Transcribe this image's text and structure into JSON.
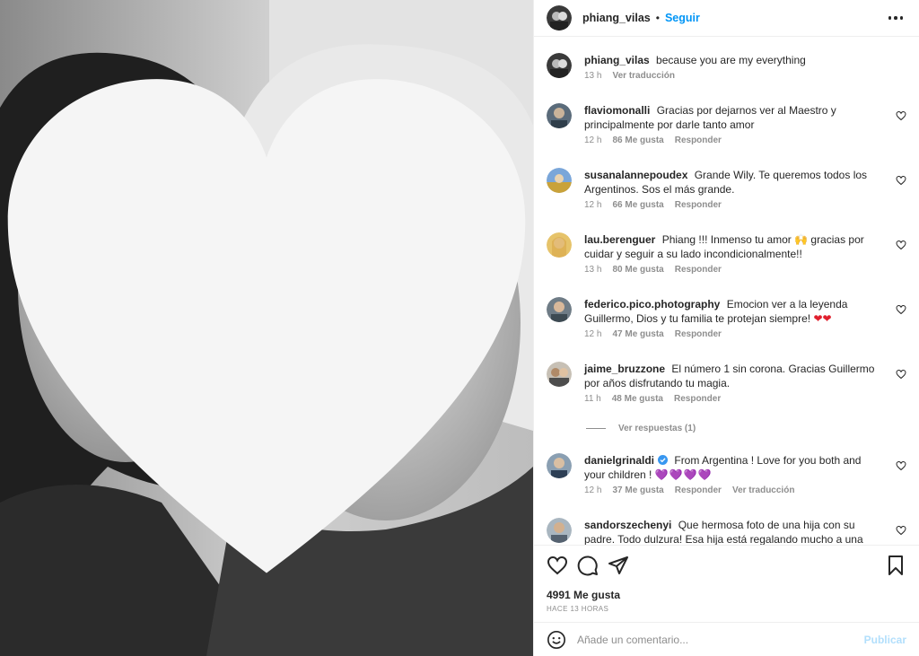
{
  "header": {
    "username": "phiang_vilas",
    "separator": "•",
    "follow_label": "Seguir",
    "more_icon": "more-options-icon"
  },
  "caption": {
    "username": "phiang_vilas",
    "text": "because you are my everything",
    "time": "13 h",
    "translate": "Ver traducción"
  },
  "comments": [
    {
      "username": "flaviomonalli",
      "text": "Gracias por dejarnos ver al Maestro y principalmente por darle tanto amor",
      "time": "12 h",
      "likes": "86 Me gusta",
      "reply": "Responder"
    },
    {
      "username": "susanalannepoudex",
      "text": "Grande Wily. Te queremos todos los Argentinos. Sos el más grande.",
      "time": "12 h",
      "likes": "66 Me gusta",
      "reply": "Responder"
    },
    {
      "username": "lau.berenguer",
      "text": "Phiang !!! Inmenso tu amor 🙌 gracias por cuidar y seguir a su lado incondicionalmente!!",
      "time": "13 h",
      "likes": "80 Me gusta",
      "reply": "Responder"
    },
    {
      "username": "federico.pico.photography",
      "text": "Emocion ver a la leyenda Guillermo, Dios y tu familia te protejan siempre!",
      "emoji": "❤❤",
      "time": "12 h",
      "likes": "47 Me gusta",
      "reply": "Responder"
    },
    {
      "username": "jaime_bruzzone",
      "text": "El número 1 sin corona. Gracias Guillermo por años disfrutando tu magia.",
      "time": "11 h",
      "likes": "48 Me gusta",
      "reply": "Responder"
    },
    {
      "username": "danielgrinaldi",
      "text": "From Argentina ! Love for you both and your children !",
      "emoji": "💜💜💜💜",
      "time": "12 h",
      "likes": "37 Me gusta",
      "reply": "Responder",
      "translate": "Ver traducción"
    },
    {
      "username": "sandorszechenyi",
      "text": "Que hermosa foto de una hija con su padre. Todo dulzura! Esa hija está regalando mucho a una persona"
    }
  ],
  "view_replies": "Ver respuestas (1)",
  "actions": {
    "likes": "4991 Me gusta",
    "time": "Hace 13 horas"
  },
  "add_comment": {
    "placeholder": "Añade un comentario...",
    "post_label": "Publicar"
  },
  "colors": {
    "accent": "#0095f6",
    "text": "#262626",
    "muted": "#8e8e8e",
    "post_disabled": "#b2dffc",
    "verified": "#3897f0"
  }
}
